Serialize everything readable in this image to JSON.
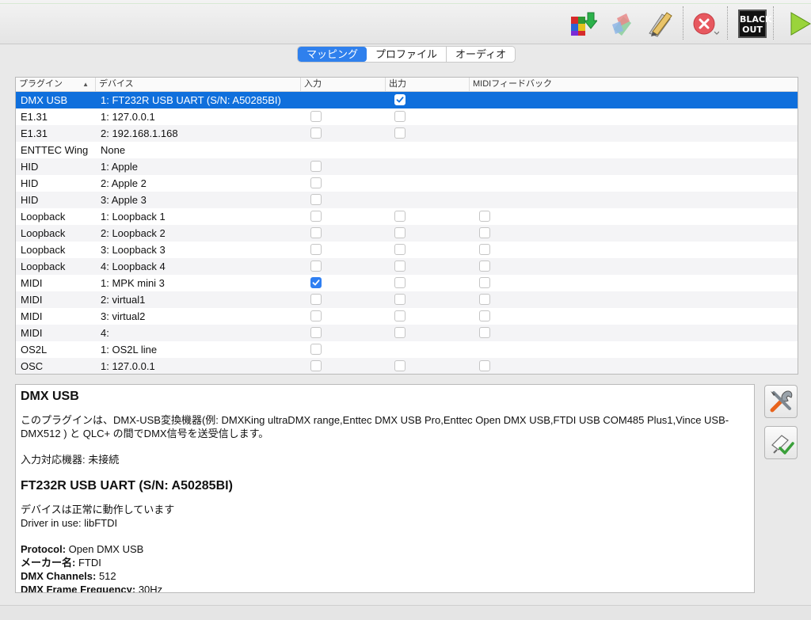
{
  "toolbar": {
    "buttons": [
      {
        "name": "add-output-icon"
      },
      {
        "name": "fixture-icon"
      },
      {
        "name": "edit-pencil-icon"
      },
      {
        "name": "stop-icon"
      },
      {
        "name": "blackout-icon",
        "label_line1": "BLACK",
        "label_line2": "OUT"
      },
      {
        "name": "play-icon"
      }
    ]
  },
  "tabs": [
    "マッピング",
    "プロファイル",
    "オーディオ"
  ],
  "grid": {
    "columns": [
      "プラグイン",
      "デバイス",
      "入力",
      "出力",
      "MIDIフィードバック"
    ],
    "rows": [
      {
        "plugin": "DMX USB",
        "device": "1: FT232R USB UART (S/N: A50285BI)",
        "input": null,
        "output": true,
        "feedback": null,
        "selected": true
      },
      {
        "plugin": "E1.31",
        "device": "1: 127.0.0.1",
        "input": false,
        "output": false,
        "feedback": null
      },
      {
        "plugin": "E1.31",
        "device": "2: 192.168.1.168",
        "input": false,
        "output": false,
        "feedback": null
      },
      {
        "plugin": "ENTTEC Wing",
        "device": "None",
        "input": null,
        "output": null,
        "feedback": null
      },
      {
        "plugin": "HID",
        "device": "1: Apple",
        "input": false,
        "output": null,
        "feedback": null
      },
      {
        "plugin": "HID",
        "device": "2: Apple  2",
        "input": false,
        "output": null,
        "feedback": null
      },
      {
        "plugin": "HID",
        "device": "3: Apple  3",
        "input": false,
        "output": null,
        "feedback": null
      },
      {
        "plugin": "Loopback",
        "device": "1: Loopback 1",
        "input": false,
        "output": false,
        "feedback": false
      },
      {
        "plugin": "Loopback",
        "device": "2: Loopback 2",
        "input": false,
        "output": false,
        "feedback": false
      },
      {
        "plugin": "Loopback",
        "device": "3: Loopback 3",
        "input": false,
        "output": false,
        "feedback": false
      },
      {
        "plugin": "Loopback",
        "device": "4: Loopback 4",
        "input": false,
        "output": false,
        "feedback": false
      },
      {
        "plugin": "MIDI",
        "device": "1: MPK mini 3",
        "input": true,
        "output": false,
        "feedback": false
      },
      {
        "plugin": "MIDI",
        "device": "2: virtual1",
        "input": false,
        "output": false,
        "feedback": false
      },
      {
        "plugin": "MIDI",
        "device": "3: virtual2",
        "input": false,
        "output": false,
        "feedback": false
      },
      {
        "plugin": "MIDI",
        "device": "4:",
        "input": false,
        "output": false,
        "feedback": false
      },
      {
        "plugin": "OS2L",
        "device": "1: OS2L line",
        "input": false,
        "output": null,
        "feedback": null
      },
      {
        "plugin": "OSC",
        "device": "1: 127.0.0.1",
        "input": false,
        "output": false,
        "feedback": false
      }
    ]
  },
  "info": {
    "title": "DMX USB",
    "description": "このプラグインは、DMX-USB変換機器(例: DMXKing ultraDMX range,Enttec DMX USB Pro,Enttec Open DMX USB,FTDI USB COM485 Plus1,Vince USB-DMX512 ) と QLC+ の間でDMX信号を送受信します。",
    "input_label": "入力対応機器:",
    "input_value": " 未接続",
    "device_title": "FT232R USB UART (S/N: A50285BI)",
    "status_line1": "デバイスは正常に動作しています",
    "status_line2": "Driver in use: libFTDI",
    "details": [
      {
        "key": "Protocol:",
        "value": " Open DMX USB"
      },
      {
        "key": "メーカー名:",
        "value": " FTDI"
      },
      {
        "key": "DMX Channels:",
        "value": " 512"
      },
      {
        "key": "DMX Frame Frequency:",
        "value": " 30Hz"
      }
    ]
  },
  "side_buttons": [
    {
      "name": "configure-icon"
    },
    {
      "name": "universe-output-icon"
    }
  ],
  "colors": {
    "selection": "#0f6fdc",
    "tab_active": "#2f80ed",
    "checkbox_on": "#2f7ff2"
  }
}
